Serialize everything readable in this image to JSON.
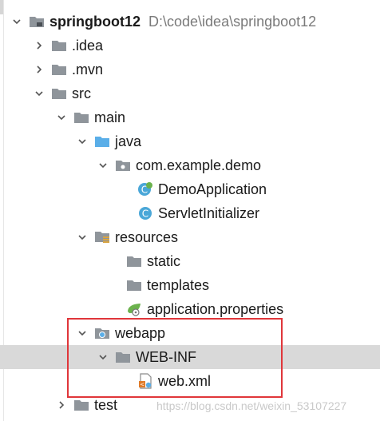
{
  "tree": {
    "project": {
      "name": "springboot12",
      "path": "D:\\code\\idea\\springboot12"
    },
    "idea": ".idea",
    "mvn": ".mvn",
    "src": "src",
    "main": "main",
    "java": "java",
    "package": "com.example.demo",
    "demo_application": "DemoApplication",
    "servlet_initializer": "ServletInitializer",
    "resources": "resources",
    "static": "static",
    "templates": "templates",
    "application_properties": "application.properties",
    "webapp": "webapp",
    "web_inf": "WEB-INF",
    "web_xml": "web.xml",
    "test": "test"
  },
  "watermark": "https://blog.csdn.net/weixin_53107227",
  "colors": {
    "folder": "#8f959b",
    "source_folder": "#5aaee8",
    "class_icon": "#4aa7d8",
    "spring_green": "#6bb24d",
    "highlight": "#e0363a",
    "selected_row": "#d9d9d9"
  },
  "icons": {
    "expand": "chevron-down-icon",
    "collapse": "chevron-right-icon",
    "folder": "folder-icon",
    "class": "class-icon"
  }
}
